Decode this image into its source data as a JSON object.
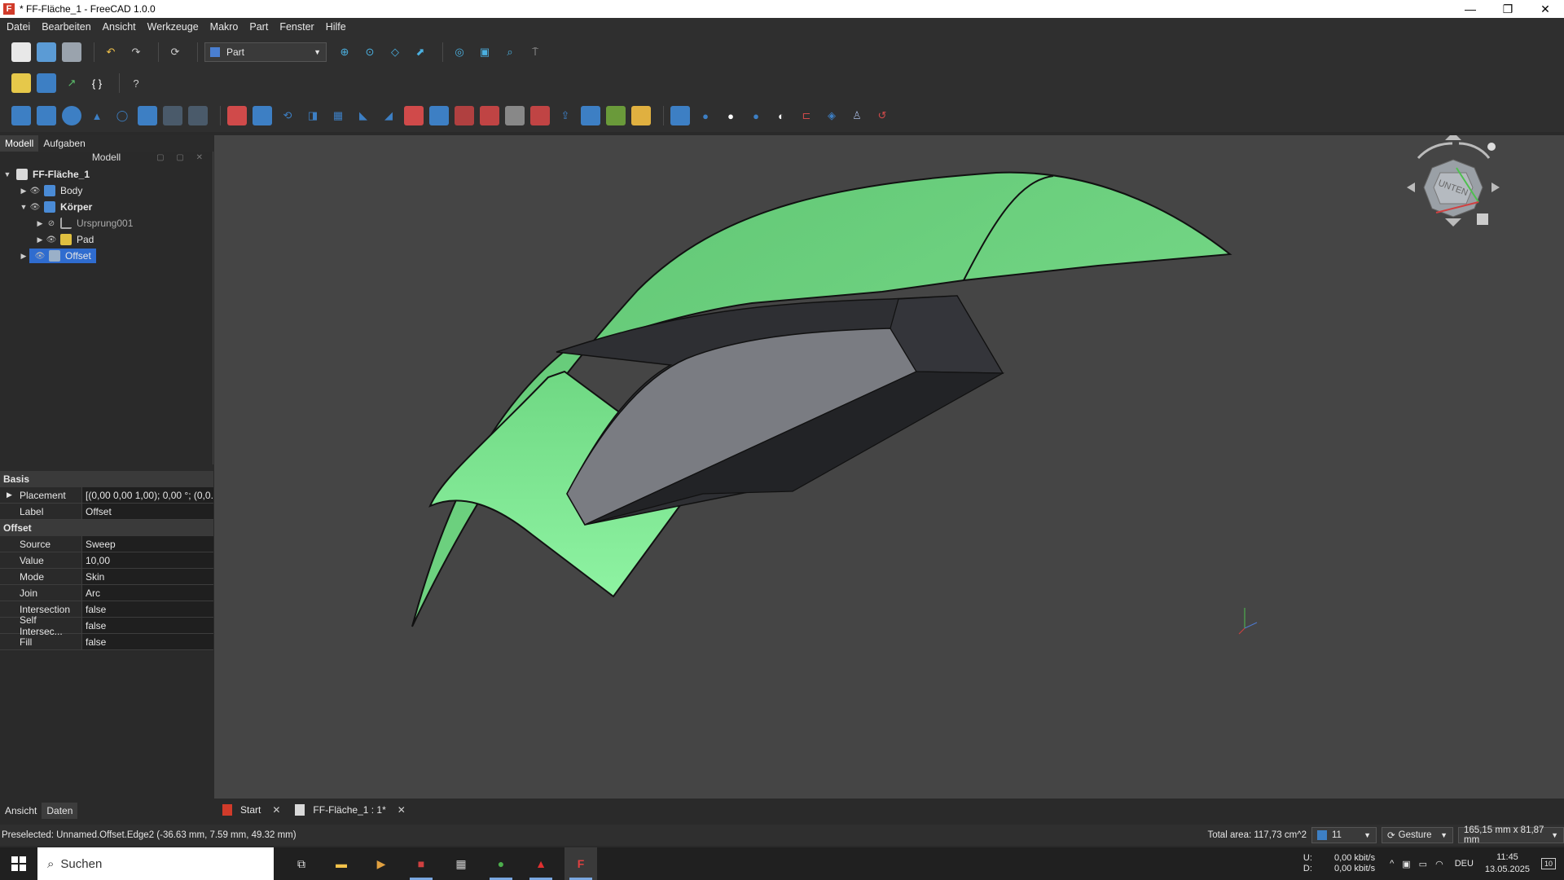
{
  "window": {
    "title": "* FF-Fläche_1 - FreeCAD 1.0.0",
    "controls": [
      "—",
      "❐",
      "✕"
    ]
  },
  "menu": [
    "Datei",
    "Bearbeiten",
    "Ansicht",
    "Werkzeuge",
    "Makro",
    "Part",
    "Fenster",
    "Hilfe"
  ],
  "workbench": {
    "selected": "Part"
  },
  "panel_tabs": [
    "Modell",
    "Aufgaben"
  ],
  "tree": {
    "header": "Modell",
    "items": [
      {
        "label": "FF-Fläche_1",
        "bold": true
      },
      {
        "label": "Body",
        "bold": false
      },
      {
        "label": "Körper",
        "bold": true
      },
      {
        "label": "Ursprung001",
        "bold": false
      },
      {
        "label": "Pad",
        "bold": false
      },
      {
        "label": "Offset",
        "bold": false,
        "selected": true
      }
    ]
  },
  "properties": {
    "group_basis": "Basis",
    "placement_key": "Placement",
    "placement_val": "[(0,00 0,00 1,00); 0,00 °; (0,0...",
    "label_key": "Label",
    "label_val": "Offset",
    "group_offset": "Offset",
    "rows": [
      {
        "k": "Source",
        "v": "Sweep"
      },
      {
        "k": "Value",
        "v": "10,00"
      },
      {
        "k": "Mode",
        "v": "Skin"
      },
      {
        "k": "Join",
        "v": "Arc"
      },
      {
        "k": "Intersection",
        "v": "false"
      },
      {
        "k": "Self Intersec...",
        "v": "false"
      },
      {
        "k": "Fill",
        "v": "false"
      }
    ]
  },
  "bottom_tabs": [
    "Ansicht",
    "Daten"
  ],
  "navcube": {
    "face_label": "UNTEN"
  },
  "doc_tabs": [
    "Start",
    "FF-Fläche_1 : 1*"
  ],
  "status": {
    "message": "Preselected: Unnamed.Offset.Edge2 (-36.63 mm, 7.59 mm, 49.32 mm)",
    "area": "Total area: 117,73 cm^2",
    "counter": "11",
    "nav_style": "Gesture",
    "dimensions": "165,15 mm x 81,87 mm"
  },
  "taskbar": {
    "search_placeholder": "Suchen",
    "net_up": "U:",
    "net_down": "D:",
    "net_up_val": "0,00 kbit/s",
    "net_down_val": "0,00 kbit/s",
    "lang": "DEU",
    "time": "11:45",
    "date": "13.05.2025",
    "notifications": "10"
  },
  "colors": {
    "surface": "#7fe08f",
    "solid_dark": "#2e2f33",
    "solid_light": "#7a7c82",
    "viewport_bg": "#454545",
    "selection": "#2f6ccf"
  }
}
